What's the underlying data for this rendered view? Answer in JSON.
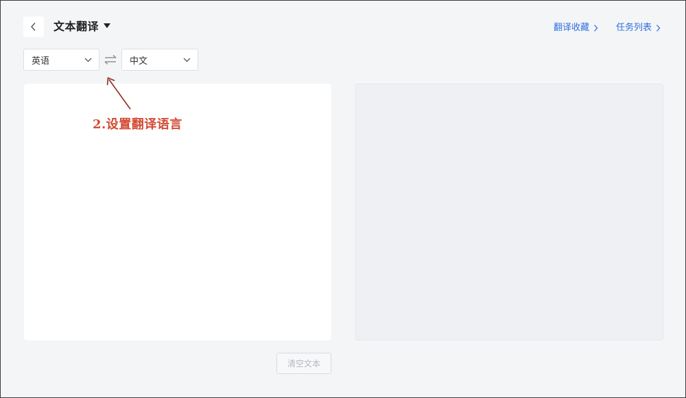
{
  "header": {
    "title": "文本翻译",
    "links": [
      {
        "label": "翻译收藏"
      },
      {
        "label": "任务列表"
      }
    ]
  },
  "language_bar": {
    "source_language": "英语",
    "target_language": "中文"
  },
  "source_panel": {
    "value": "",
    "placeholder": ""
  },
  "target_panel": {
    "value": ""
  },
  "actions": {
    "clear_label": "清空文本"
  },
  "annotation": {
    "text": "2.设置翻译语言",
    "color": "#d24a32"
  },
  "colors": {
    "link": "#2e6fe0",
    "background": "#f4f5f7",
    "output_panel": "#eef0f3"
  },
  "icons": {
    "back": "chevron-left-icon",
    "title_dropdown": "caret-down-icon",
    "link_arrow": "chevron-right-icon",
    "select_arrow": "chevron-down-icon",
    "swap": "swap-arrows-icon"
  }
}
